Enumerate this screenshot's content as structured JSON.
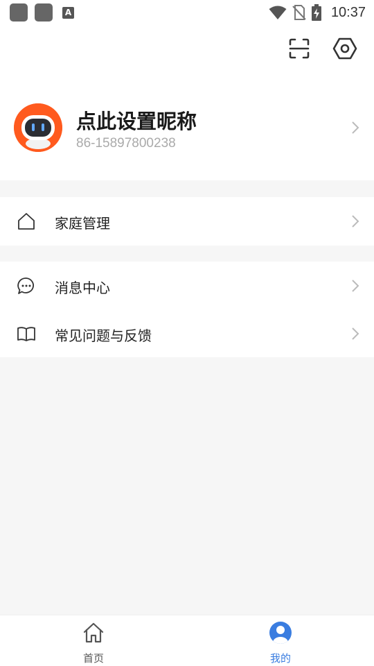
{
  "status_bar": {
    "time": "10:37",
    "notification_glyph": "A"
  },
  "header": {
    "scan_icon": "scan-icon",
    "settings_icon": "settings-icon"
  },
  "profile": {
    "nickname": "点此设置昵称",
    "phone": "86-15897800238",
    "avatar_color": "#ff5a1e"
  },
  "menu": {
    "home_management": "家庭管理",
    "message_center": "消息中心",
    "faq_feedback": "常见问题与反馈"
  },
  "tabbar": {
    "home_label": "首页",
    "mine_label": "我的",
    "active_color": "#3a7de0",
    "inactive_color": "#555555"
  }
}
